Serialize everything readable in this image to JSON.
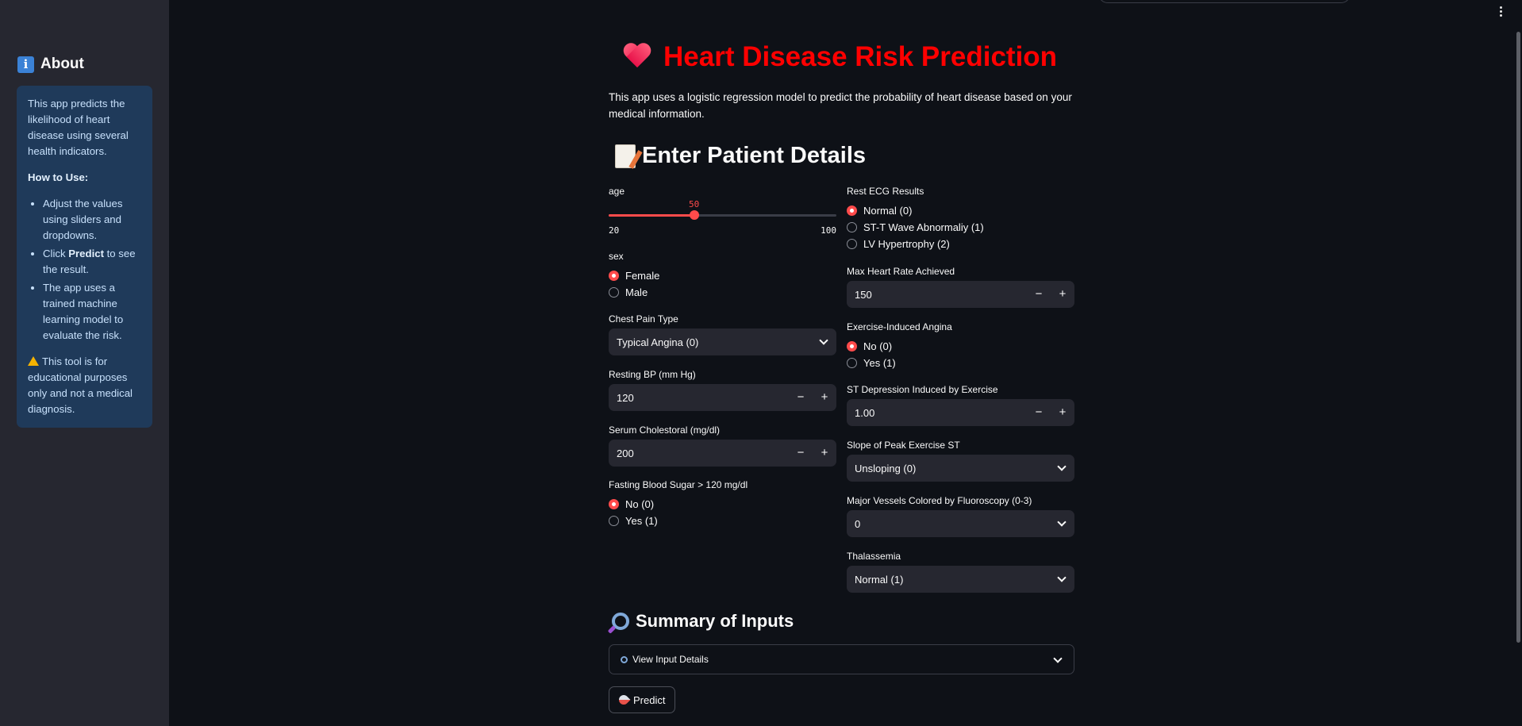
{
  "sidebar": {
    "title": "About",
    "intro": "This app predicts the likelihood of heart disease using several health indicators.",
    "how_to_use_heading": "How to Use:",
    "steps": [
      {
        "pre": "Adjust the values using sliders and dropdowns.",
        "bold": "",
        "post": ""
      },
      {
        "pre": "Click ",
        "bold": "Predict",
        "post": " to see the result."
      },
      {
        "pre": "The app uses a trained machine learning model to evaluate the risk.",
        "bold": "",
        "post": ""
      }
    ],
    "disclaimer": "This tool is for educational purposes only and not a medical diagnosis."
  },
  "header": {
    "title": "Heart Disease Risk Prediction",
    "description": "This app uses a logistic regression model to predict the probability of heart disease based on your medical information."
  },
  "form": {
    "section_title": "Enter Patient Details",
    "age": {
      "label": "age",
      "value": "50",
      "min": "20",
      "max": "100",
      "fraction": 0.375
    },
    "sex": {
      "label": "sex",
      "options": [
        "Female",
        "Male"
      ],
      "selected": 0
    },
    "chest_pain": {
      "label": "Chest Pain Type",
      "value": "Typical Angina (0)"
    },
    "resting_bp": {
      "label": "Resting BP (mm Hg)",
      "value": "120"
    },
    "cholesterol": {
      "label": "Serum Cholestoral (mg/dl)",
      "value": "200"
    },
    "fbs": {
      "label": "Fasting Blood Sugar > 120 mg/dl",
      "options": [
        "No (0)",
        "Yes (1)"
      ],
      "selected": 0
    },
    "restecg": {
      "label": "Rest ECG Results",
      "options": [
        "Normal (0)",
        "ST-T Wave Abnormaliy (1)",
        "LV Hypertrophy (2)"
      ],
      "selected": 0
    },
    "max_hr": {
      "label": "Max Heart Rate Achieved",
      "value": "150"
    },
    "exang": {
      "label": "Exercise-Induced Angina",
      "options": [
        "No (0)",
        "Yes (1)"
      ],
      "selected": 0
    },
    "oldpeak": {
      "label": "ST Depression Induced by Exercise",
      "value": "1.00"
    },
    "slope": {
      "label": "Slope of Peak Exercise ST",
      "value": "Unsloping (0)"
    },
    "ca": {
      "label": "Major Vessels Colored by Fluoroscopy (0-3)",
      "value": "0"
    },
    "thal": {
      "label": "Thalassemia",
      "value": "Normal (1)"
    },
    "stepper_minus": "−",
    "stepper_plus": "+"
  },
  "summary": {
    "section_title": "Summary of Inputs",
    "expander_label": "View Input Details"
  },
  "predict_button": "Predict",
  "colors": {
    "accent": "#ff4b4b",
    "title": "#ff0000",
    "background": "#0e1117",
    "sidebar": "#262730",
    "info_box": "#1f3a5a"
  }
}
